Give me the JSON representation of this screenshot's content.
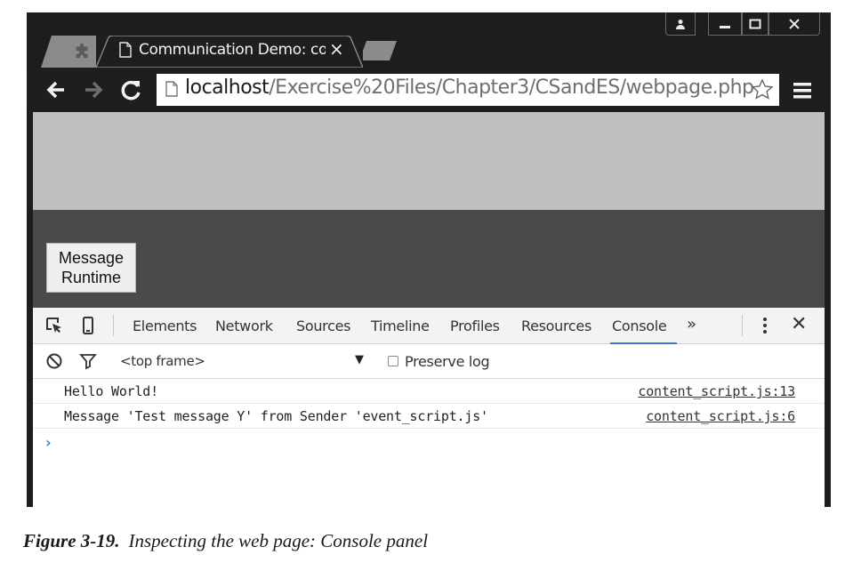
{
  "browser": {
    "tab_title": "Communication Demo: co",
    "tab_close": "×",
    "url_host": "localhost",
    "url_path": "/Exercise%20Files/Chapter3/CSandES/webpage.php"
  },
  "page": {
    "button_line1": "Message",
    "button_line2": "Runtime"
  },
  "devtools": {
    "tabs": [
      "Elements",
      "Network",
      "Sources",
      "Timeline",
      "Profiles",
      "Resources",
      "Console"
    ],
    "active_tab": "Console",
    "more": "»",
    "close": "✕",
    "frame_select": "<top frame>",
    "frame_caret": "▼",
    "preserve_log": "Preserve log",
    "preserve_checked": false,
    "console_rows": [
      {
        "message": "Hello World!",
        "source": "content_script.js:13"
      },
      {
        "message": "Message 'Test message Y' from Sender 'event_script.js'",
        "source": "content_script.js:6"
      }
    ],
    "prompt": "›"
  },
  "caption": {
    "label": "Figure 3-19.",
    "text": "Inspecting the web page: Console panel"
  },
  "colors": {
    "frame": "#1d1d1d",
    "page_top": "#bfbfbf",
    "page_mid": "#4c4a49",
    "devtools_accent": "#3a7bd5"
  },
  "icons": {
    "extension_tab": "puzzle-icon",
    "tab_page": "page-icon",
    "back": "arrow-left-icon",
    "forward": "arrow-right-icon",
    "reload": "reload-icon",
    "bookmark": "star-icon",
    "menu": "hamburger-icon",
    "inspect": "inspect-element-icon",
    "device": "device-mode-icon",
    "clear": "clear-console-icon",
    "filter": "filter-icon"
  }
}
